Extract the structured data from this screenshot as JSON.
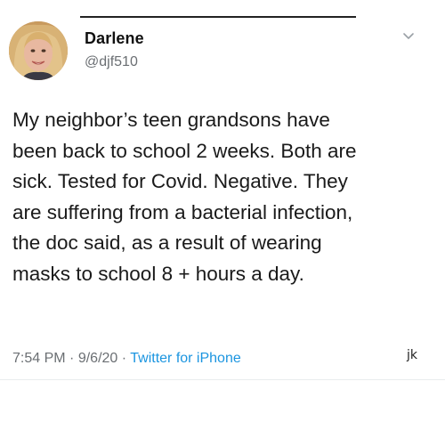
{
  "tweet": {
    "author": {
      "display_name": "Darlene",
      "handle": "@djf510",
      "avatar_icon": "profile-photo"
    },
    "menu_icon": "chevron-down-icon",
    "text": "My neighbor’s teen grandsons have\nbeen back to school 2 weeks. Both are\nsick. Tested for Covid. Negative. They\nare suffering from a bacterial infection,\nthe doc said, as a result of wearing\nmasks to school 8 + hours a day.",
    "time": "7:54 PM",
    "separator": "·",
    "date": "9/6/20",
    "source": "Twitter for iPhone",
    "source_color": "#1b95e0"
  },
  "watermark": "jk"
}
